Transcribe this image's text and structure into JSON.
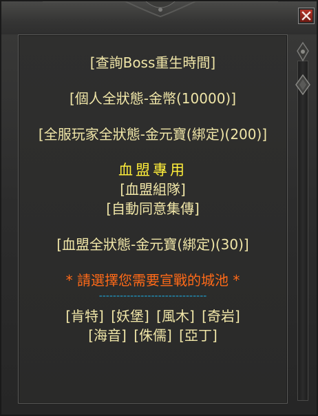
{
  "window": {
    "close_label": "X"
  },
  "menu": {
    "query_boss": "[查詢Boss重生時間]",
    "personal_buff": "[個人全狀態-金幣(10000)]",
    "server_buff": "[全服玩家全狀態-金元寶(綁定)(200)]",
    "clan_heading": "血盟專用",
    "clan_team": "[血盟組隊]",
    "auto_teleport": "[自動同意集傳]",
    "clan_buff": "[血盟全狀態-金元寶(綁定)(30)]",
    "prompt": "* 請選擇您需要宣戰的城池 *",
    "divider": "-------------------------------"
  },
  "castles": [
    "[肯特]",
    "[妖堡]",
    "[風木]",
    "[奇岩]",
    "[海音]",
    "[侏儒]",
    "[亞丁]"
  ],
  "colors": {
    "link": "#f0e6a8",
    "heading": "#ffee3a",
    "prompt": "#ff6a18",
    "divider": "#1ea6d8"
  }
}
